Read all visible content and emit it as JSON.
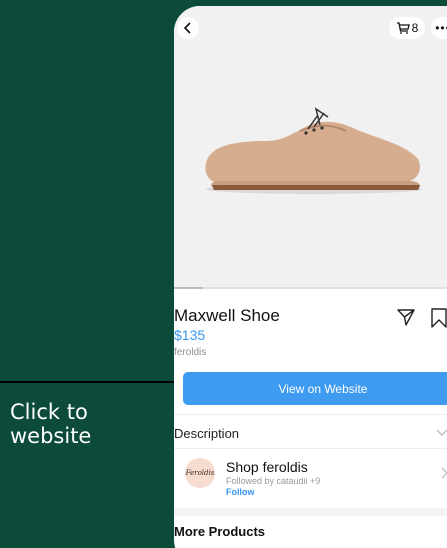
{
  "annotation": {
    "line1": "Click to",
    "line2": "website"
  },
  "topbar": {
    "back_icon": "chevron-left-icon",
    "cart_icon": "shopping-bag-icon",
    "cart_count": "8",
    "more_icon": "more-horizontal-icon",
    "more_label": "•••"
  },
  "product": {
    "name": "Maxwell Shoe",
    "price": "$135",
    "seller": "feroldis",
    "image_progress": 0.1
  },
  "actions": {
    "share_icon": "paper-plane-icon",
    "save_icon": "bookmark-icon",
    "cta_label": "View on Website"
  },
  "description": {
    "label": "Description"
  },
  "shop": {
    "avatar_text": "Feroldis",
    "name": "Shop feroldis",
    "followed_by": "Followed by cataudii +9",
    "follow_label": "Follow"
  },
  "more_products": {
    "label": "More Products"
  },
  "colors": {
    "background": "#0c4a3a",
    "accent": "#3e9bf0",
    "link": "#3797f0"
  }
}
